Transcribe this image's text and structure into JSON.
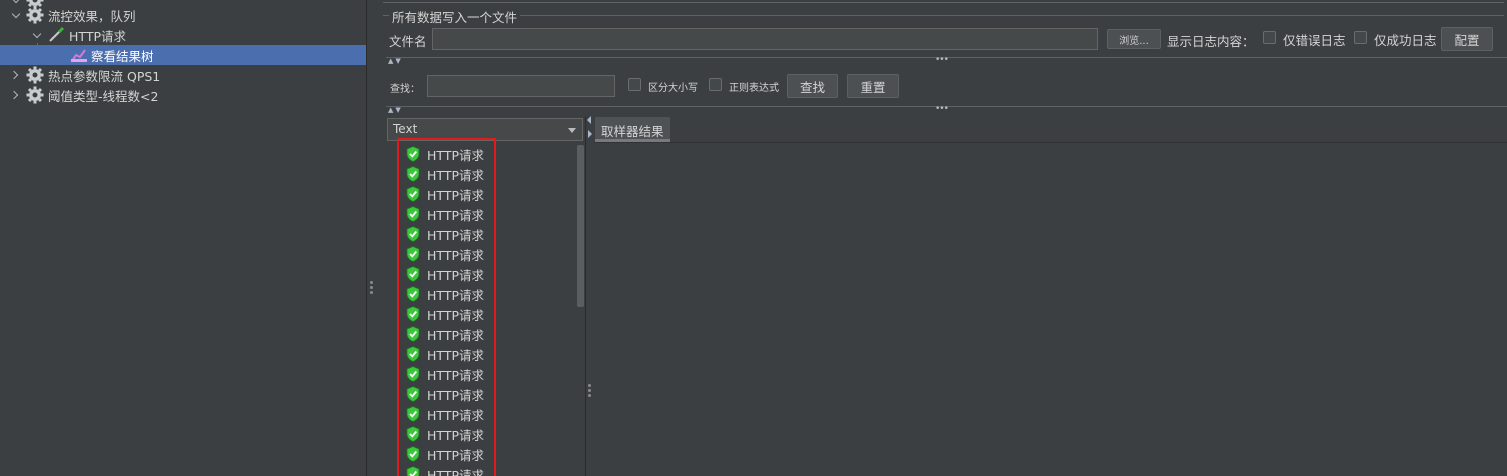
{
  "tree": {
    "items": [
      {
        "label": "流控效果，队列",
        "icon": "gear-icon"
      },
      {
        "label": "HTTP请求",
        "icon": "pipette-icon"
      },
      {
        "label": "察看结果树",
        "icon": "chart-icon"
      },
      {
        "label": "热点参数限流 QPS1",
        "icon": "gear-icon"
      },
      {
        "label": "阈值类型-线程数<2",
        "icon": "gear-icon"
      }
    ]
  },
  "file_section": {
    "legend": "所有数据写入一个文件",
    "filename_label": "文件名",
    "filename_value": "",
    "browse_label": "浏览...",
    "log_content_label": "显示日志内容：",
    "errors_only_label": "仅错误日志",
    "success_only_label": "仅成功日志",
    "config_label": "配置"
  },
  "search": {
    "label": "查找：",
    "value": "",
    "case_label": "区分大小写",
    "regex_label": "正则表达式",
    "find_label": "查找",
    "reset_label": "重置"
  },
  "results": {
    "renderer": "Text",
    "items": [
      "HTTP请求",
      "HTTP请求",
      "HTTP请求",
      "HTTP请求",
      "HTTP请求",
      "HTTP请求",
      "HTTP请求",
      "HTTP请求",
      "HTTP请求",
      "HTTP请求",
      "HTTP请求",
      "HTTP请求",
      "HTTP请求",
      "HTTP请求",
      "HTTP请求",
      "HTTP请求",
      "HTTP请求"
    ]
  },
  "detail": {
    "tab_label": "取样器结果"
  },
  "colors": {
    "background": "#3c3f41",
    "selection": "#4b6eaf",
    "highlight_box": "#e01b1b",
    "success_green": "#3cc83c"
  }
}
